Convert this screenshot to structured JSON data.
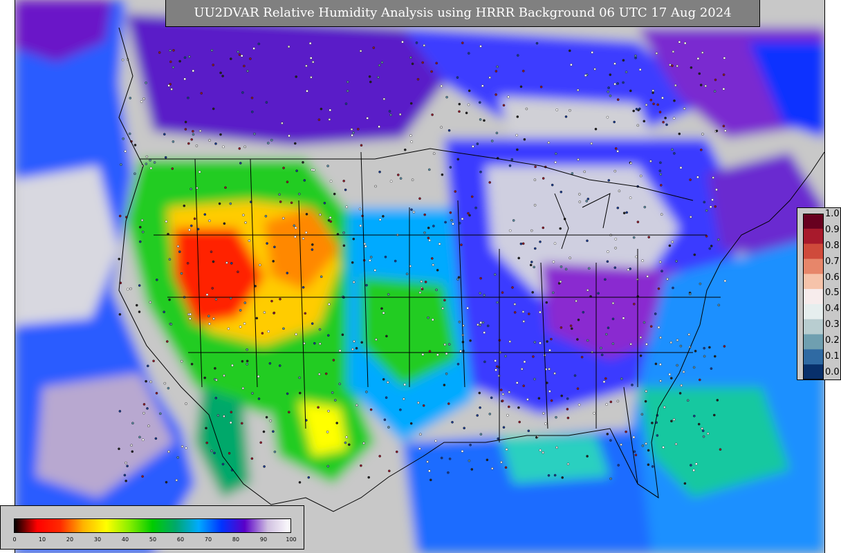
{
  "map": {
    "title": "UU2DVAR Relative Humidity Analysis using HRRR Background 06 UTC 17 Aug 2024"
  },
  "obs_colorbar": {
    "labels": [
      "1.0",
      "0.9",
      "0.8",
      "0.7",
      "0.6",
      "0.5",
      "0.4",
      "0.3",
      "0.2",
      "0.1",
      "0.0"
    ],
    "colors": [
      "#67001f",
      "#a81a2c",
      "#cf4a3b",
      "#e7866a",
      "#f6c3aa",
      "#f7ecec",
      "#e6eeee",
      "#b8cdd0",
      "#6f9fb0",
      "#2f6aa3",
      "#08306b"
    ]
  },
  "rh_colorbar": {
    "tick_labels": [
      "0",
      "10",
      "20",
      "30",
      "40",
      "50",
      "60",
      "70",
      "80",
      "90",
      "100"
    ],
    "stops": [
      "#000000",
      "#ff0000",
      "#ff2a00",
      "#ffb400",
      "#ffff00",
      "#88ee00",
      "#00cc00",
      "#00a86b",
      "#00aaff",
      "#0033ff",
      "#5a00c8",
      "#d0c0e0",
      "#ffffff"
    ]
  }
}
